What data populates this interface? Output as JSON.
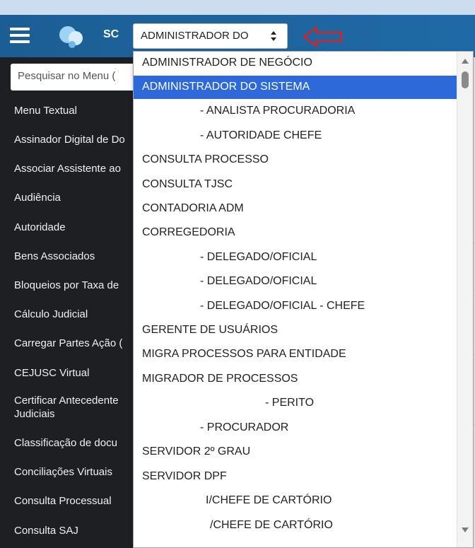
{
  "header": {
    "org_code": "SC",
    "role_select_value": "ADMINISTRADOR DO",
    "colors": {
      "bar": "#1b5e95",
      "annotation_arrow": "#e02020",
      "selected_option": "#2d69d9"
    }
  },
  "sidebar": {
    "search_placeholder": "Pesquisar no Menu (",
    "items": [
      {
        "label": "Menu Textual"
      },
      {
        "label": "Assinador Digital de Do"
      },
      {
        "label": "Associar Assistente ao"
      },
      {
        "label": "Audiência"
      },
      {
        "label": "Autoridade"
      },
      {
        "label": "Bens Associados"
      },
      {
        "label": "Bloqueios por Taxa de"
      },
      {
        "label": "Cálculo Judicial"
      },
      {
        "label": "Carregar Partes Ação ("
      },
      {
        "label": "CEJUSC Virtual"
      },
      {
        "label": "Certificar Antecedente",
        "label2": "Judiciais"
      },
      {
        "label": "Classificação de docu"
      },
      {
        "label": "Conciliações Virtuais"
      },
      {
        "label": "Consulta Processual"
      },
      {
        "label": "Consulta SAJ"
      }
    ]
  },
  "dropdown": {
    "options": [
      {
        "label": "ADMINISTRADOR DE NEGÓCIO"
      },
      {
        "label": "ADMINISTRADOR DO SISTEMA",
        "selected": true
      },
      {
        "label": "- ANALISTA PROCURADORIA"
      },
      {
        "label": "- AUTORIDADE CHEFE"
      },
      {
        "label": "CONSULTA PROCESSO"
      },
      {
        "label": "CONSULTA TJSC"
      },
      {
        "label": "CONTADORIA ADM"
      },
      {
        "label": "CORREGEDORIA"
      },
      {
        "label": "- DELEGADO/OFICIAL"
      },
      {
        "label": "- DELEGADO/OFICIAL"
      },
      {
        "label": "- DELEGADO/OFICIAL - CHEFE"
      },
      {
        "label": "GERENTE DE USUÁRIOS"
      },
      {
        "label": "MIGRA PROCESSOS PARA ENTIDADE"
      },
      {
        "label": "MIGRADOR DE PROCESSOS"
      },
      {
        "label": "- PERITO"
      },
      {
        "label": "- PROCURADOR"
      },
      {
        "label": "SERVIDOR 2º GRAU"
      },
      {
        "label": "SERVIDOR DPF"
      },
      {
        "label": "I/CHEFE DE CARTÓRIO"
      },
      {
        "label": "/CHEFE DE CARTÓRIO"
      }
    ]
  }
}
